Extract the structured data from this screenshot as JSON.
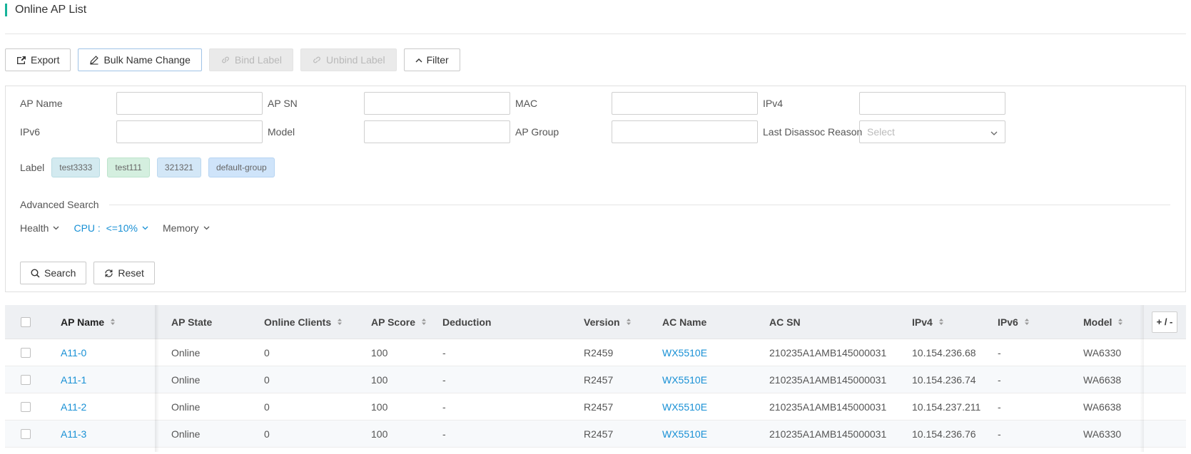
{
  "page": {
    "title": "Online AP List"
  },
  "toolbar": {
    "export_label": "Export",
    "bulk_name_change_label": "Bulk Name Change",
    "bind_label_label": "Bind Label",
    "unbind_label_label": "Unbind Label",
    "filter_label": "Filter"
  },
  "filters": {
    "ap_name_label": "AP Name",
    "ap_sn_label": "AP SN",
    "mac_label": "MAC",
    "ipv4_label": "IPv4",
    "ipv6_label": "IPv6",
    "model_label": "Model",
    "ap_group_label": "AP Group",
    "last_disassoc_label": "Last Disassoc Reason",
    "last_disassoc_placeholder": "Select",
    "label_title": "Label",
    "tags": [
      {
        "text": "test3333",
        "color": "#d3eaf0"
      },
      {
        "text": "test111",
        "color": "#d4efdf"
      },
      {
        "text": "321321",
        "color": "#d3e7f7"
      },
      {
        "text": "default-group",
        "color": "#cfe4fa"
      }
    ],
    "advanced_title": "Advanced Search",
    "health_label": "Health",
    "cpu_label": "CPU :  <=10%",
    "memory_label": "Memory",
    "search_label": "Search",
    "reset_label": "Reset"
  },
  "table": {
    "columns": [
      "AP Name",
      "AP State",
      "Online Clients",
      "AP Score",
      "Deduction",
      "Version",
      "AC Name",
      "AC SN",
      "IPv4",
      "IPv6",
      "Model"
    ],
    "plus_label": "+ / -",
    "rows": [
      {
        "name": "A11-0",
        "state": "Online",
        "clients": "0",
        "score": "100",
        "deduction": "-",
        "version": "R2459",
        "ac_name": "WX5510E",
        "ac_sn": "210235A1AMB145000031",
        "ipv4": "10.154.236.68",
        "ipv6": "-",
        "model": "WA6330"
      },
      {
        "name": "A11-1",
        "state": "Online",
        "clients": "0",
        "score": "100",
        "deduction": "-",
        "version": "R2457",
        "ac_name": "WX5510E",
        "ac_sn": "210235A1AMB145000031",
        "ipv4": "10.154.236.74",
        "ipv6": "-",
        "model": "WA6638"
      },
      {
        "name": "A11-2",
        "state": "Online",
        "clients": "0",
        "score": "100",
        "deduction": "-",
        "version": "R2457",
        "ac_name": "WX5510E",
        "ac_sn": "210235A1AMB145000031",
        "ipv4": "10.154.237.211",
        "ipv6": "-",
        "model": "WA6638"
      },
      {
        "name": "A11-3",
        "state": "Online",
        "clients": "0",
        "score": "100",
        "deduction": "-",
        "version": "R2457",
        "ac_name": "WX5510E",
        "ac_sn": "210235A1AMB145000031",
        "ipv4": "10.154.236.76",
        "ipv6": "-",
        "model": "WA6330"
      }
    ]
  }
}
